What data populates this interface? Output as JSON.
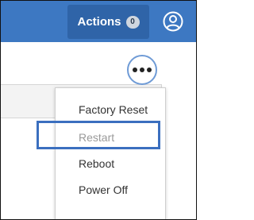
{
  "header": {
    "actions_label": "Actions",
    "actions_count": "0",
    "user_icon": "user-circle-icon"
  },
  "more_menu": {
    "trigger_icon": "ellipsis-icon",
    "items": [
      {
        "label": "Factory Reset"
      },
      {
        "label": "Restart"
      },
      {
        "label": "Reboot"
      },
      {
        "label": "Power Off"
      }
    ]
  },
  "colors": {
    "header_bg": "#3d78c2",
    "actions_bg": "#2f64a8",
    "highlight_border": "#3b6fbf"
  }
}
